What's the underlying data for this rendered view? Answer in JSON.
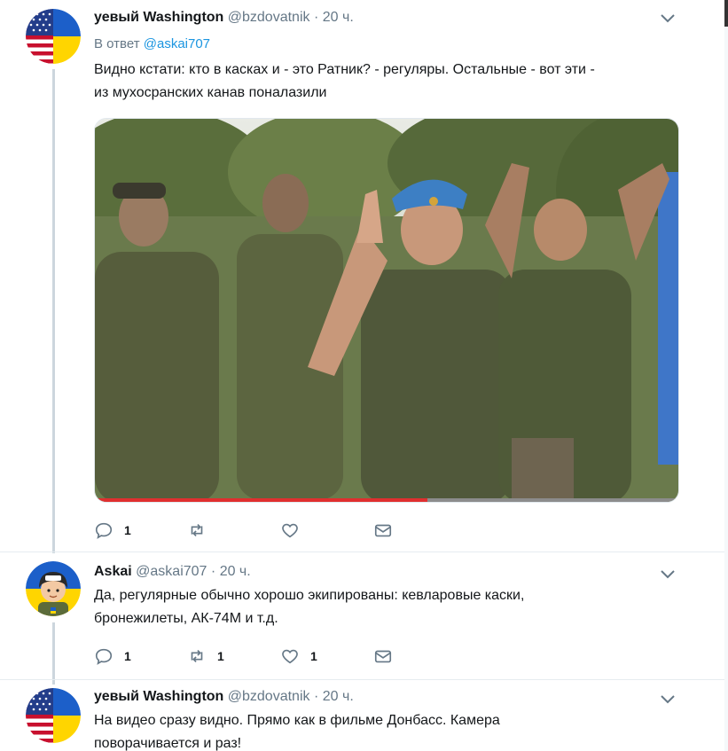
{
  "tweets": [
    {
      "name": "уевый Washington",
      "handle": "@bzdovatnik",
      "time": "20 ч.",
      "reply_prefix": "В ответ",
      "reply_mention": "@askai707",
      "text_line1": "Видно кстати: кто в касках и - это Ратник? - регуляры. Остальные - вот эти -",
      "text_line2": "из мухосранских канав поналазили",
      "avatar_icon": "usa-ukraine-flag-icon",
      "video_progress": 0.57,
      "replies": "1",
      "retweets": "",
      "likes": ""
    },
    {
      "name": "Askai",
      "handle": "@askai707",
      "time": "20 ч.",
      "text_line1": "Да, регулярные обычно хорошо экипированы: кевларовые каски,",
      "text_line2": "бронежилеты, АК-74М и т.д.",
      "avatar_icon": "soldier-cartoon-avatar-icon",
      "replies": "1",
      "retweets": "1",
      "likes": "1"
    },
    {
      "name": "уевый Washington",
      "handle": "@bzdovatnik",
      "time": "20 ч.",
      "text_line1": "На видео сразу видно.  Прямо как в фильме Донбасс. Камера",
      "text_line2": "поворачивается и раз!",
      "avatar_icon": "usa-ukraine-flag-icon"
    }
  ],
  "separator": "·",
  "colors": {
    "text": "#14171a",
    "secondary": "#657786",
    "link": "#1b95e0",
    "thread_line": "#ccd6dd",
    "ukraine_blue": "#1c5fc9",
    "ukraine_yellow": "#ffd500"
  }
}
